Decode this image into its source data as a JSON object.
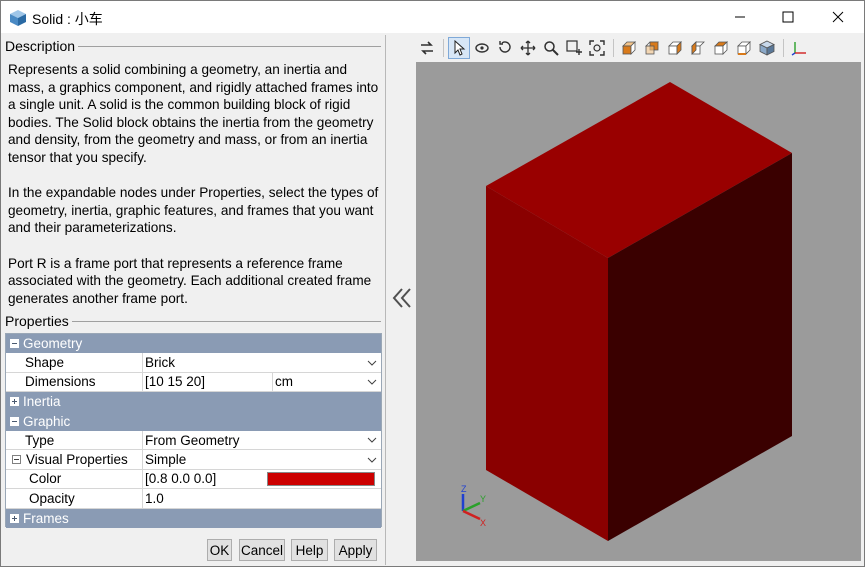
{
  "window": {
    "title": "Solid : 小车",
    "controls": {
      "minimize": "minimize-icon",
      "maximize": "maximize-icon",
      "close": "close-icon"
    }
  },
  "description": {
    "header": "Description",
    "paragraphs": [
      "Represents a solid combining a geometry, an inertia and mass, a graphics component, and rigidly attached frames into a single unit. A solid is the common building block of rigid bodies. The Solid block obtains the inertia from the geometry and density, from the geometry and mass, or from an inertia tensor that you specify.",
      "In the expandable nodes under Properties, select the types of geometry, inertia, graphic features, and frames that you want and their parameterizations.",
      "Port R is a frame port that represents a reference frame associated with the geometry. Each additional created frame generates another frame port."
    ]
  },
  "properties": {
    "header": "Properties",
    "geometry": {
      "label": "Geometry",
      "shape_label": "Shape",
      "shape_value": "Brick",
      "dimensions_label": "Dimensions",
      "dimensions_value": "[10 15 20]",
      "dimensions_unit": "cm"
    },
    "inertia": {
      "label": "Inertia"
    },
    "graphic": {
      "label": "Graphic",
      "type_label": "Type",
      "type_value": "From Geometry",
      "visual_label": "Visual Properties",
      "visual_value": "Simple",
      "color_label": "Color",
      "color_value": "[0.8 0.0 0.0]",
      "color_swatch": "#cc0000",
      "opacity_label": "Opacity",
      "opacity_value": "1.0"
    },
    "frames": {
      "label": "Frames"
    }
  },
  "buttons": {
    "ok": "OK",
    "cancel": "Cancel",
    "help": "Help",
    "apply": "Apply"
  },
  "toolbar": {
    "tools": [
      "swap-icon",
      "select-arrow-icon",
      "rotate-icon",
      "roll-icon",
      "pan-icon",
      "zoom-icon",
      "zoom-box-icon",
      "fit-view-icon"
    ],
    "views": [
      "front-view-icon",
      "back-view-icon",
      "left-view-icon",
      "right-view-icon",
      "top-view-icon",
      "bottom-view-icon",
      "isometric-view-icon",
      "axes-toggle-icon"
    ],
    "active": "select-arrow-icon"
  },
  "viewport": {
    "background": "#9b9b9b",
    "solid_colors": {
      "top": "#990000",
      "front": "#8a0000",
      "side": "#3a0000"
    },
    "triad": {
      "x": "X",
      "y": "Y",
      "z": "Z"
    }
  }
}
